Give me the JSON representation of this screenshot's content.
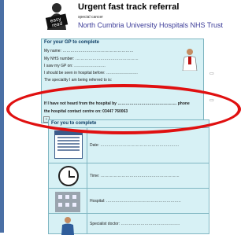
{
  "header": {
    "title": "Urgent fast track referral",
    "small_text": "special cancer",
    "trust": "North Cumbria University Hospitals NHS Trust"
  },
  "logo": {
    "text_line1": "easy",
    "text_line2": "read"
  },
  "gp_section": {
    "heading": "For your GP to complete",
    "lines": [
      "My name: ………………………………………………",
      "My NHS number: …………………………………………",
      "I saw my GP on: ……………………",
      "I should be seen in hospital before: ……………………",
      "The speciality I am being referred to is:"
    ],
    "highlight_line": "If I have not heard from the hospital by ……………………………………… phone",
    "contact_line": "the hospital contact centre on: 03447 760063"
  },
  "you_section": {
    "heading": "For you to complete",
    "rows": [
      {
        "label": "Date: ……………………………………………………"
      },
      {
        "label": "Time: ……………………………………………………"
      },
      {
        "label": "Hospital: …………………………………………………"
      },
      {
        "label": "Specialist doctor: ………………………………………"
      }
    ]
  },
  "annotation": {
    "color": "#e01010"
  },
  "colors": {
    "box_bg": "#d7f1f5",
    "border": "#7fb6c2",
    "title_blue": "#3b3b98"
  }
}
